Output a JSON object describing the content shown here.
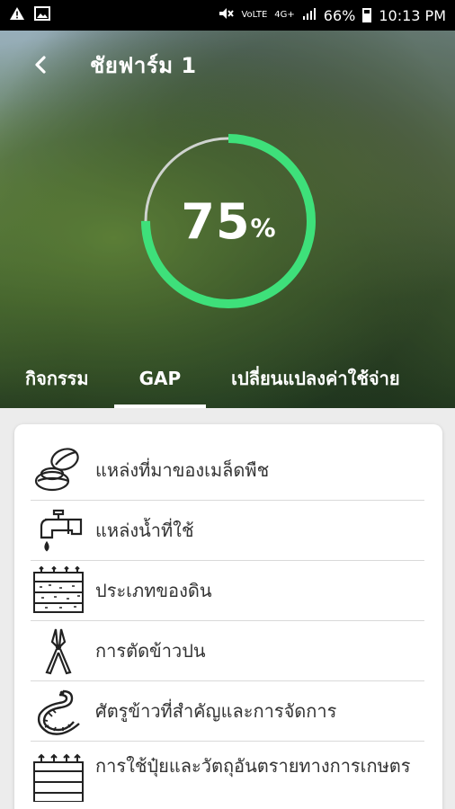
{
  "status_bar": {
    "left_icons": [
      "warning-icon",
      "image-icon"
    ],
    "right_icons": [
      "mute-icon",
      "volte-icon",
      "4g-icon",
      "signal-icon",
      "battery-icon"
    ],
    "volte_label": "VoLTE",
    "network_label": "4G+",
    "battery_percent": "66%",
    "time": "10:13 PM"
  },
  "header": {
    "title": "ชัยฟาร์ม 1",
    "back_icon": "back-arrow-icon"
  },
  "progress": {
    "value": 75,
    "value_label": "75",
    "unit_label": "%",
    "accent_color": "#3ee07a",
    "track_color": "#cfd3cf"
  },
  "tabs": [
    {
      "label": "กิจกรรม",
      "active": false
    },
    {
      "label": "GAP",
      "active": true
    },
    {
      "label": "เปลี่ยนแปลงค่าใช้จ่าย",
      "active": false
    }
  ],
  "gap_items": [
    {
      "label": "แหล่งที่มาของเมล็ดพืช",
      "icon": "seed-icon"
    },
    {
      "label": "แหล่งน้ำที่ใช้",
      "icon": "water-tap-icon"
    },
    {
      "label": "ประเภทของดิน",
      "icon": "soil-icon"
    },
    {
      "label": "การตัดข้าวปน",
      "icon": "pruning-shears-icon"
    },
    {
      "label": "ศัตรูข้าวที่สำคัญและการจัดการ",
      "icon": "worm-pest-icon"
    },
    {
      "label": "การใช้ปุ๋ยและวัตถุอันตรายทางการเกษตร",
      "icon": "fertilizer-soil-icon"
    }
  ]
}
